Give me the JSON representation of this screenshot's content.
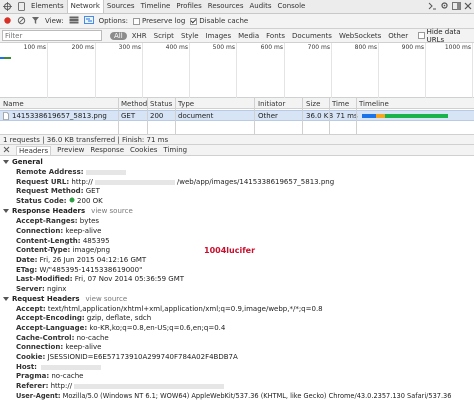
{
  "tabbar": {
    "tabs": [
      "Elements",
      "Network",
      "Sources",
      "Timeline",
      "Profiles",
      "Resources",
      "Audits",
      "Console"
    ],
    "active": "Network"
  },
  "toolbar": {
    "view_label": "View:",
    "options_label": "Options:",
    "preserve_log_label": "Preserve log",
    "disable_cache_label": "Disable cache",
    "preserve_log_checked": false,
    "disable_cache_checked": true
  },
  "filter": {
    "placeholder": "Filter",
    "types": [
      "All",
      "XHR",
      "Script",
      "Style",
      "Images",
      "Media",
      "Fonts",
      "Documents",
      "WebSockets",
      "Other"
    ],
    "active_type": "All",
    "hide_data_urls_label": "Hide data URLs"
  },
  "overview": {
    "ticks": [
      "100 ms",
      "200 ms",
      "300 ms",
      "400 ms",
      "500 ms",
      "600 ms",
      "700 ms",
      "800 ms",
      "900 ms",
      "1000 ms"
    ]
  },
  "grid": {
    "columns": [
      "Name",
      "Method",
      "Status",
      "Type",
      "Initiator",
      "Size",
      "Time",
      "Timeline"
    ],
    "row": {
      "name": "1415338619657_5813.png",
      "method": "GET",
      "status": "200",
      "type": "document",
      "initiator": "Other",
      "size": "36.0 KB",
      "time": "71 ms"
    }
  },
  "summary": "1 requests | 36.0 KB transferred | Finish: 71 ms",
  "detail_tabs": [
    "Headers",
    "Preview",
    "Response",
    "Cookies",
    "Timing"
  ],
  "active_detail_tab": "Headers",
  "general": {
    "title": "General",
    "remote_address_key": "Remote Address:",
    "request_url_key": "Request URL:",
    "request_url_prefix": "http://",
    "request_url_suffix": "/web/app/images/1415338619657_5813.png",
    "request_method_key": "Request Method:",
    "request_method_val": "GET",
    "status_code_key": "Status Code:",
    "status_code_val": "200 OK"
  },
  "response_headers": {
    "title": "Response Headers",
    "view_source": "view source",
    "rows": [
      {
        "k": "Accept-Ranges:",
        "v": "bytes"
      },
      {
        "k": "Connection:",
        "v": "keep-alive"
      },
      {
        "k": "Content-Length:",
        "v": "485395"
      },
      {
        "k": "Content-Type:",
        "v": "image/png"
      },
      {
        "k": "Date:",
        "v": "Fri, 26 Jun 2015 04:12:16 GMT"
      },
      {
        "k": "ETag:",
        "v": "W/\"485395-1415338619000\""
      },
      {
        "k": "Last-Modified:",
        "v": "Fri, 07 Nov 2014 05:36:59 GMT"
      },
      {
        "k": "Server:",
        "v": "nginx"
      }
    ]
  },
  "watermark": "1004lucifer",
  "request_headers": {
    "title": "Request Headers",
    "view_source": "view source",
    "rows": [
      {
        "k": "Accept:",
        "v": "text/html,application/xhtml+xml,application/xml;q=0.9,image/webp,*/*;q=0.8"
      },
      {
        "k": "Accept-Encoding:",
        "v": "gzip, deflate, sdch"
      },
      {
        "k": "Accept-Language:",
        "v": "ko-KR,ko;q=0.8,en-US;q=0.6,en;q=0.4"
      },
      {
        "k": "Cache-Control:",
        "v": "no-cache"
      },
      {
        "k": "Connection:",
        "v": "keep-alive"
      },
      {
        "k": "Cookie:",
        "v": "JSESSIONID=E6E57173910A299740F784A02F4BDB7A"
      },
      {
        "k": "Host:",
        "v": ""
      },
      {
        "k": "Pragma:",
        "v": "no-cache"
      },
      {
        "k": "Referer:",
        "v": "http://"
      },
      {
        "k": "User-Agent:",
        "v": "Mozilla/5.0 (Windows NT 6.1; WOW64) AppleWebKit/537.36 (KHTML, like Gecko) Chrome/43.0.2357.130 Safari/537.36"
      }
    ]
  },
  "colors": {
    "selected_row": "#d6e4f5",
    "timeline_blue": "#1a73e8",
    "timeline_green": "#19b24b",
    "timeline_waiting": "#f5a623",
    "status_dot": "#2e9e44",
    "watermark": "#c8102e"
  }
}
